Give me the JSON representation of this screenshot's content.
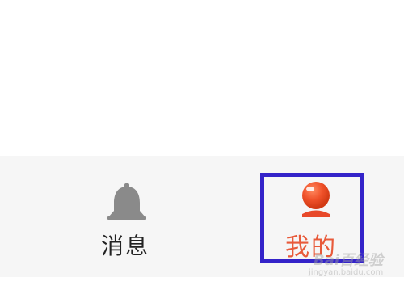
{
  "tabbar": {
    "messages": {
      "label": "消息",
      "icon": "bell-icon",
      "color": "#222222",
      "icon_color": "#8a8a8a"
    },
    "mine": {
      "label": "我的",
      "icon": "person-icon",
      "color": "#e85a3a",
      "selected": true,
      "highlighted": true
    },
    "background": "#f6f6f6"
  },
  "highlight": {
    "color": "#3423c9"
  },
  "watermark": {
    "main": "Bai百经验",
    "sub": "jingyan.baidu.com"
  }
}
